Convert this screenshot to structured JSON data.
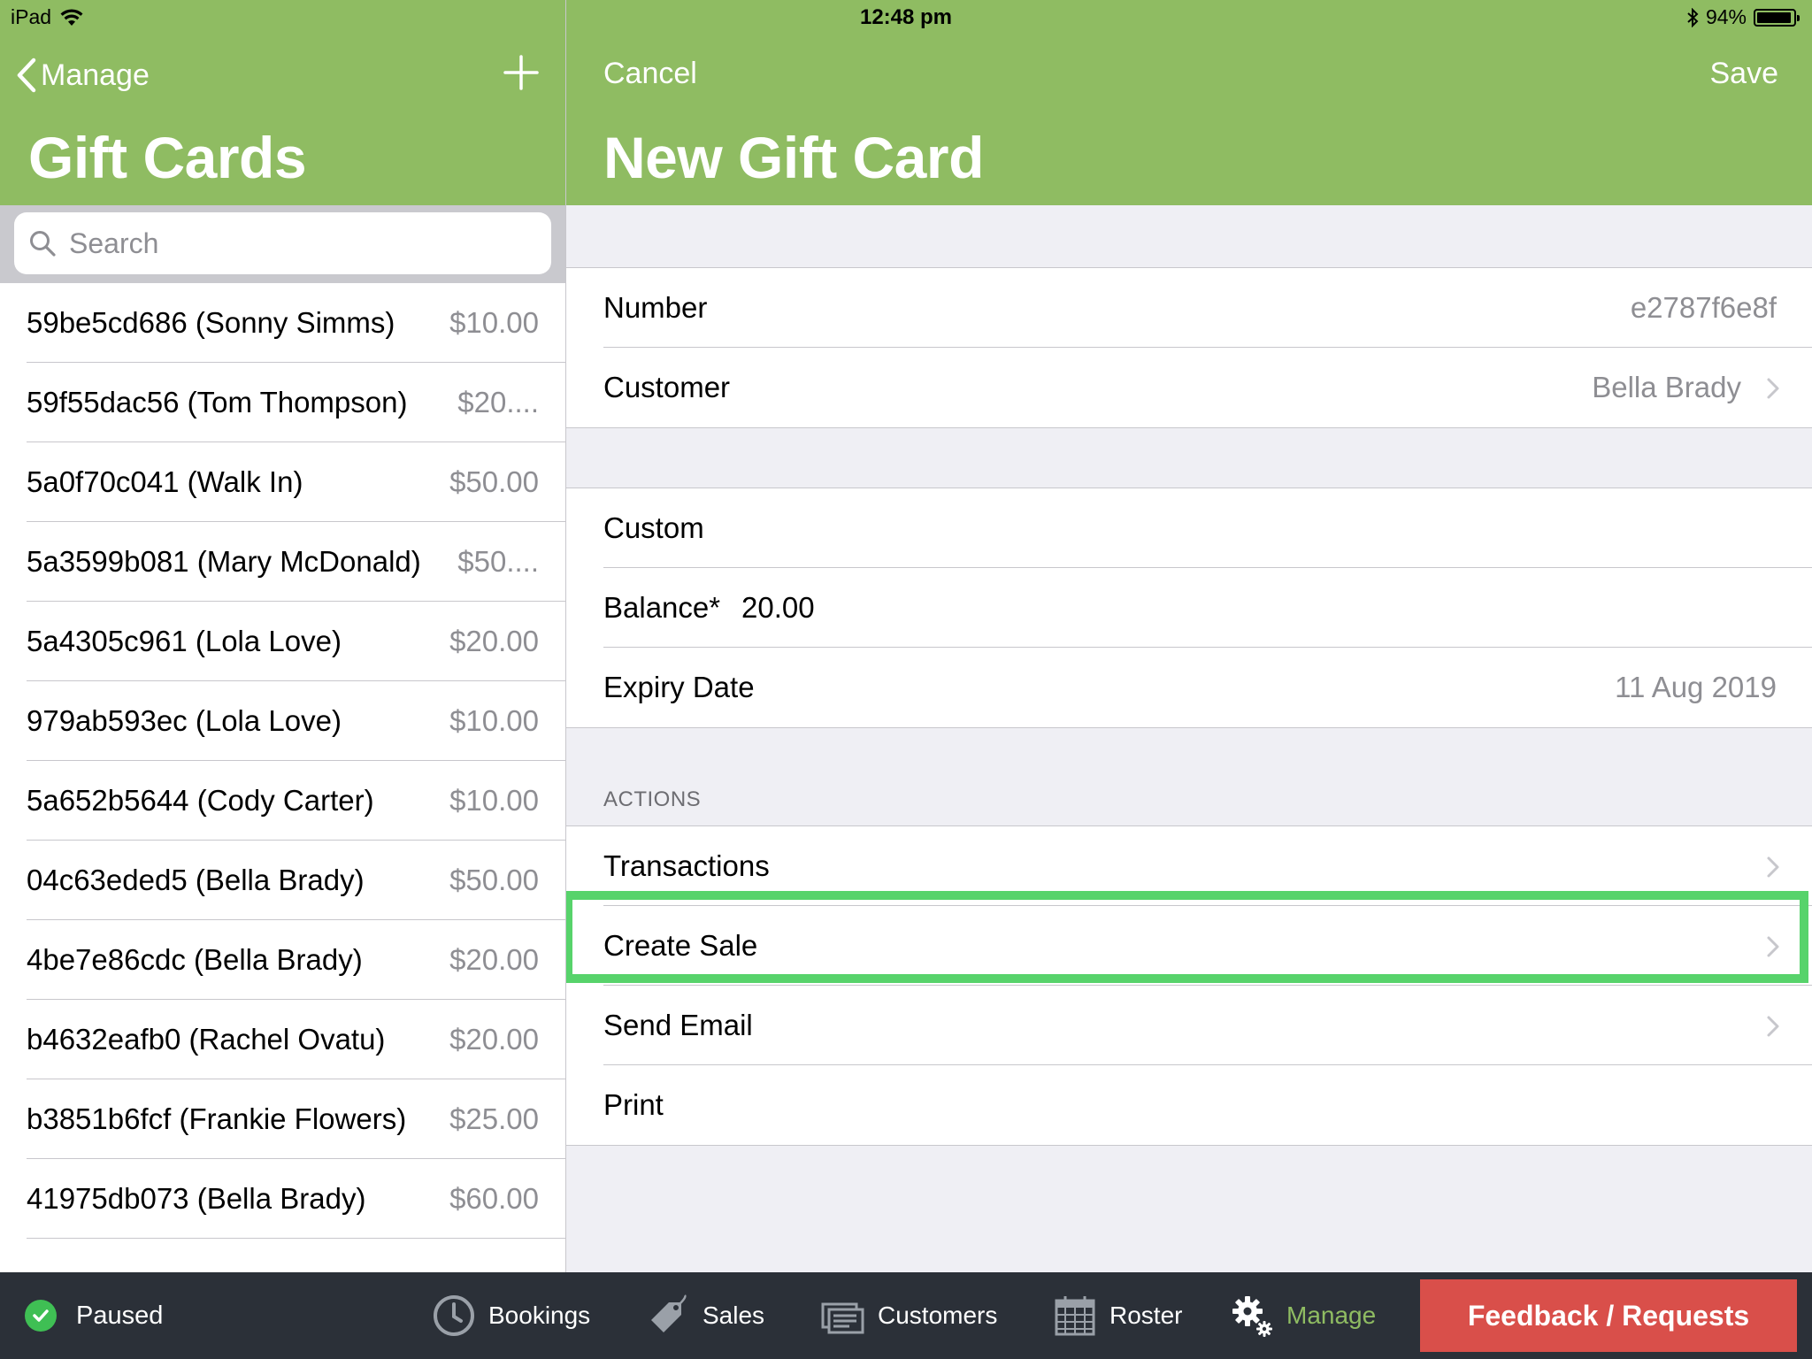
{
  "status_bar": {
    "device": "iPad",
    "time": "12:48 pm",
    "battery": "94%"
  },
  "master": {
    "back_label": "Manage",
    "title": "Gift Cards",
    "search_placeholder": "Search",
    "items": [
      {
        "name": "59be5cd686 (Sonny Simms)",
        "amount": "$10.00"
      },
      {
        "name": "59f55dac56 (Tom Thompson)",
        "amount": "$20...."
      },
      {
        "name": "5a0f70c041 (Walk In)",
        "amount": "$50.00"
      },
      {
        "name": "5a3599b081 (Mary McDonald)",
        "amount": "$50...."
      },
      {
        "name": "5a4305c961 (Lola Love)",
        "amount": "$20.00"
      },
      {
        "name": "979ab593ec (Lola Love)",
        "amount": "$10.00"
      },
      {
        "name": "5a652b5644 (Cody  Carter)",
        "amount": "$10.00"
      },
      {
        "name": "04c63eded5 (Bella Brady)",
        "amount": "$50.00"
      },
      {
        "name": "4be7e86cdc (Bella Brady)",
        "amount": "$20.00"
      },
      {
        "name": "b4632eafb0 (Rachel Ovatu)",
        "amount": "$20.00"
      },
      {
        "name": "b3851b6fcf (Frankie Flowers)",
        "amount": "$25.00"
      },
      {
        "name": "41975db073 (Bella Brady)",
        "amount": "$60.00"
      }
    ]
  },
  "detail": {
    "cancel_label": "Cancel",
    "save_label": "Save",
    "title": "New Gift Card",
    "number_label": "Number",
    "number_value": "e2787f6e8f",
    "customer_label": "Customer",
    "customer_value": "Bella Brady",
    "custom_label": "Custom",
    "balance_label": "Balance*",
    "balance_value": "20.00",
    "expiry_label": "Expiry Date",
    "expiry_value": "11 Aug 2019",
    "actions_header": "ACTIONS",
    "actions": {
      "transactions": "Transactions",
      "create_sale": "Create Sale",
      "send_email": "Send Email",
      "print": "Print"
    }
  },
  "tabbar": {
    "status": "Paused",
    "tabs": {
      "bookings": "Bookings",
      "sales": "Sales",
      "customers": "Customers",
      "roster": "Roster",
      "manage": "Manage"
    },
    "feedback_label": "Feedback / Requests"
  },
  "colors": {
    "nav_green": "#8fbc62",
    "highlight_green": "#57d36b",
    "tabbar_bg": "#2b3038",
    "feedback_red": "#d94f4a"
  }
}
